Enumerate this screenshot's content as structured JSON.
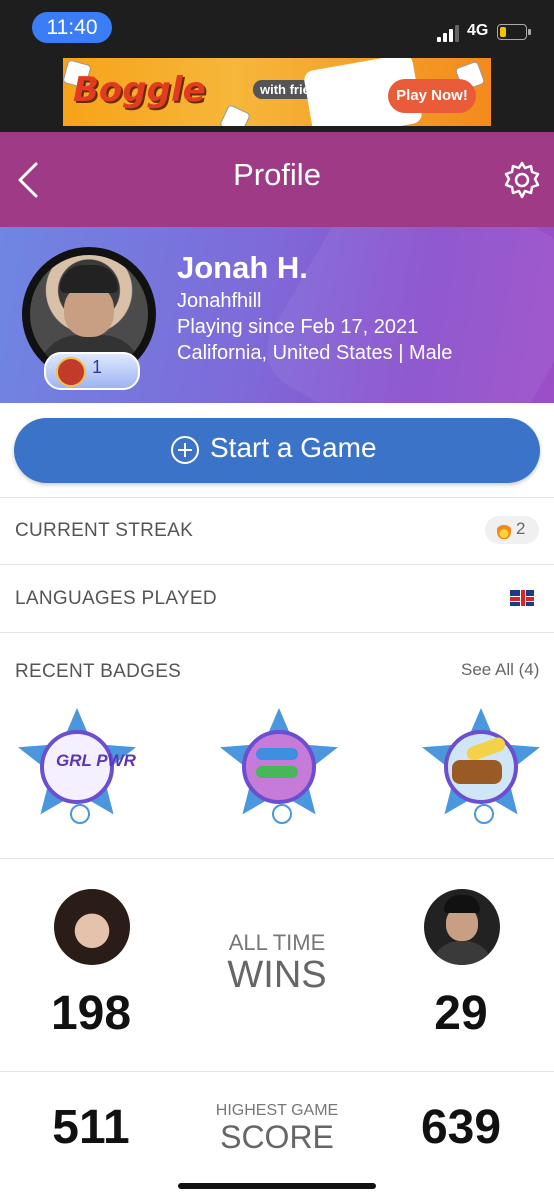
{
  "status_bar": {
    "time": "11:40",
    "network": "4G",
    "battery_level": 0.25
  },
  "ad": {
    "brand": "Boggle",
    "tag": "with friends",
    "cta": "Play Now!"
  },
  "nav": {
    "title": "Profile",
    "back_icon": "chevron-left-icon",
    "settings_icon": "gear-icon"
  },
  "profile": {
    "name": "Jonah H.",
    "username": "Jonahfhill",
    "since": "Playing since Feb 17, 2021",
    "location": "California, United States | Male",
    "level": "1"
  },
  "start_button": {
    "label": "Start a Game"
  },
  "streak": {
    "label": "CURRENT STREAK",
    "value": "2"
  },
  "languages": {
    "label": "LANGUAGES PLAYED",
    "flag": "uk-flag-icon"
  },
  "badges": {
    "label": "RECENT BADGES",
    "see_all": "See All (4)",
    "items": [
      "GRL PWR",
      "koinobori",
      "banana bread"
    ]
  },
  "wins": {
    "label_small": "ALL TIME",
    "label_big": "WINS",
    "left": "198",
    "right": "29"
  },
  "score": {
    "label_small": "HIGHEST GAME",
    "label_big": "SCORE",
    "left": "511",
    "right": "639"
  },
  "colors": {
    "nav": "#9e3a86",
    "button": "#3b73c9",
    "time_pill": "#3b7df6"
  }
}
